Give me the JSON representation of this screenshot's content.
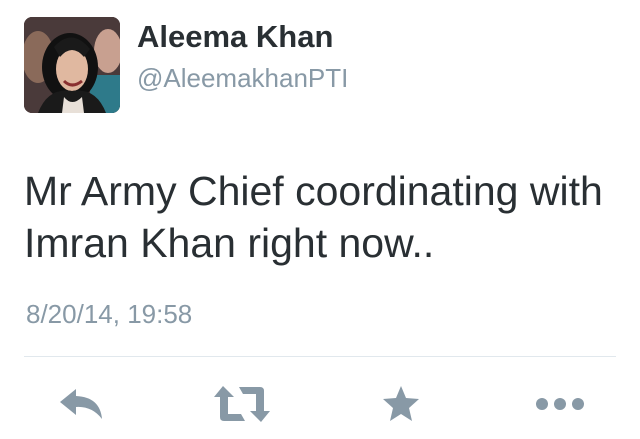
{
  "tweet": {
    "display_name": "Aleema Khan",
    "handle": "@AleemakhanPTI",
    "text": "Mr Army Chief coordinating with Imran Khan right now..",
    "timestamp": "8/20/14, 19:58"
  },
  "actions": [
    {
      "name": "reply",
      "icon": "reply-icon"
    },
    {
      "name": "retweet",
      "icon": "retweet-icon"
    },
    {
      "name": "favorite",
      "icon": "star-icon"
    },
    {
      "name": "more",
      "icon": "more-icon"
    }
  ],
  "colors": {
    "text": "#292f33",
    "secondary": "#8899a6",
    "icon": "#8899a6",
    "divider": "#e1e8ed"
  }
}
